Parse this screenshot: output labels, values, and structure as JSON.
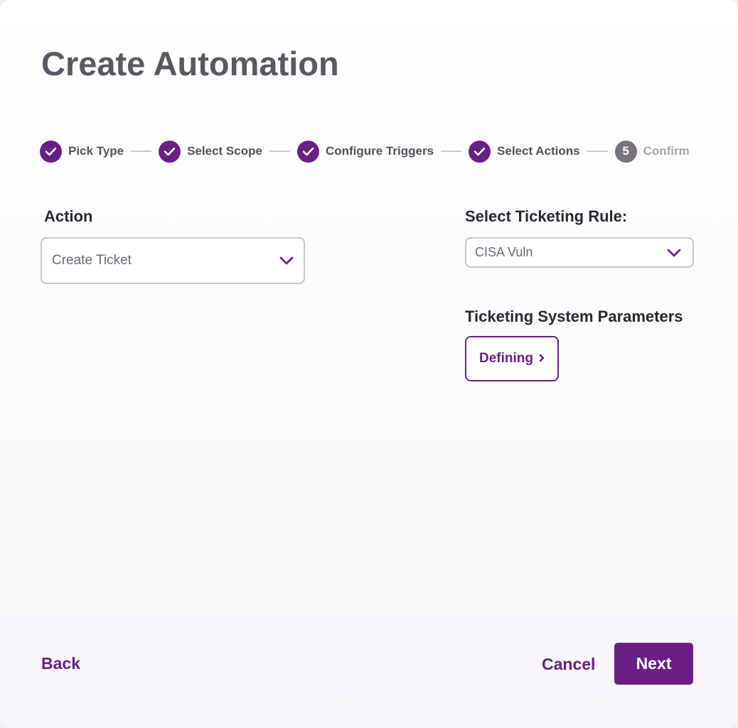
{
  "header": {
    "title": "Create Automation"
  },
  "stepper": {
    "steps": [
      {
        "label": "Pick Type",
        "status": "complete"
      },
      {
        "label": "Select Scope",
        "status": "complete"
      },
      {
        "label": "Configure Triggers",
        "status": "complete"
      },
      {
        "label": "Select Actions",
        "status": "complete"
      },
      {
        "label": "Confirm",
        "status": "pending",
        "number": "5"
      }
    ]
  },
  "action": {
    "label": "Action",
    "selected": "Create Ticket"
  },
  "ticketing_rule": {
    "label": "Select Ticketing Rule:",
    "selected": "CISA Vuln"
  },
  "params": {
    "label": "Ticketing System Parameters",
    "button_label": "Defining"
  },
  "footer": {
    "back_label": "Back",
    "cancel_label": "Cancel",
    "next_label": "Next"
  },
  "colors": {
    "accent": "#6a1f85",
    "title": "#5b5662",
    "border": "#c9c6cd",
    "pending_step": "#77727d"
  },
  "icons": {
    "complete_step": "check-icon",
    "select": "chevron-down-icon",
    "defining": "chevron-right-icon"
  }
}
